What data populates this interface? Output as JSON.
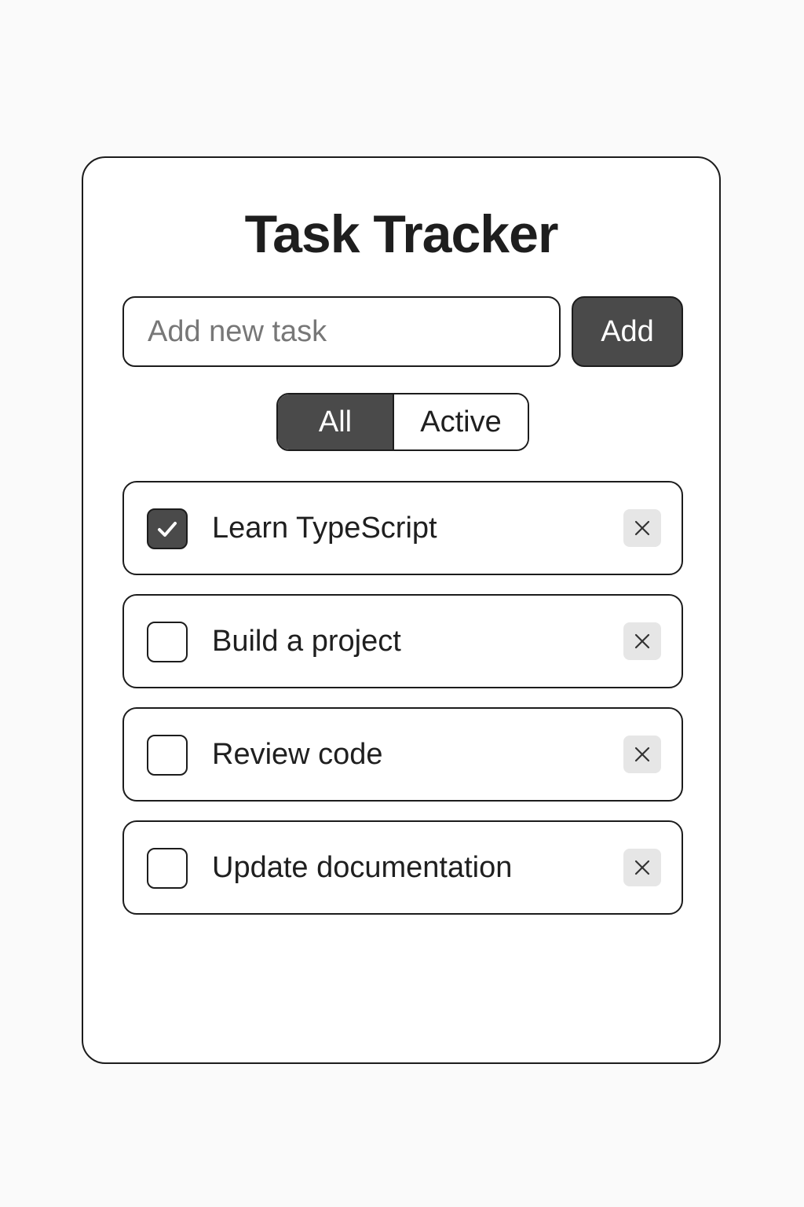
{
  "app": {
    "title": "Task Tracker"
  },
  "new_task": {
    "placeholder": "Add new task",
    "value": "",
    "add_label": "Add"
  },
  "filters": {
    "selected": "All",
    "options": [
      "All",
      "Active"
    ]
  },
  "tasks": [
    {
      "label": "Learn TypeScript",
      "done": true
    },
    {
      "label": "Build a project",
      "done": false
    },
    {
      "label": "Review code",
      "done": false
    },
    {
      "label": "Update documentation",
      "done": false
    }
  ],
  "colors": {
    "accent_dark": "#4a4a4a",
    "border": "#1c1c1c",
    "delete_bg": "#e6e6e6",
    "background": "#fafafa"
  },
  "icons": {
    "check": "check-icon",
    "delete": "close-icon"
  }
}
